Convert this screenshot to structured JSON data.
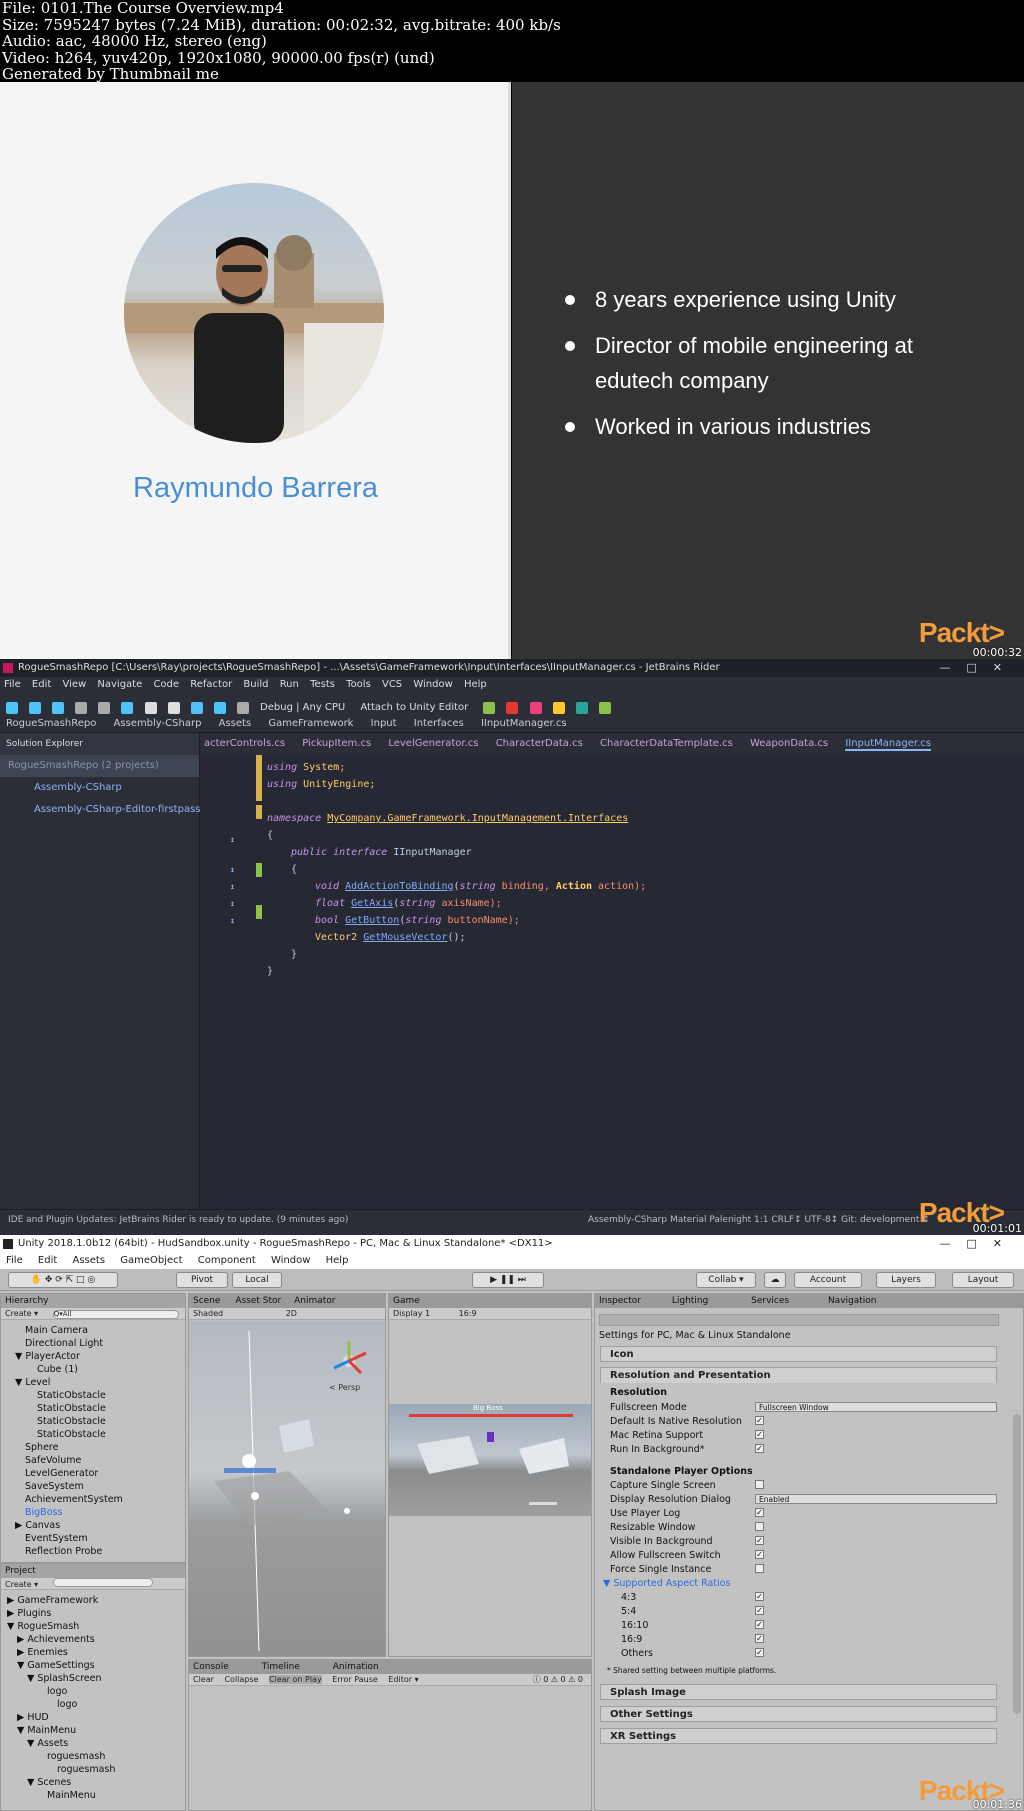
{
  "file_info": [
    "File: 0101.The Course Overview.mp4",
    "Size: 7595247 bytes (7.24 MiB), duration: 00:02:32, avg.bitrate: 400 kb/s",
    "Audio: aac, 48000 Hz, stereo (eng)",
    "Video: h264, yuv420p, 1920x1080, 90000.00 fps(r) (und)",
    "Generated by Thumbnail me"
  ],
  "brand": "Packt>",
  "frame1": {
    "timestamp": "00:00:32",
    "presenter_name": "Raymundo Barrera",
    "bullets": [
      "8 years experience using Unity",
      "Director of mobile engineering at edutech company",
      "Worked in various industries"
    ]
  },
  "frame2": {
    "timestamp": "00:01:01",
    "title": "RogueSmashRepo [C:\\Users\\Ray\\projects\\RogueSmashRepo] - ...\\Assets\\GameFramework\\Input\\Interfaces\\IInputManager.cs - JetBrains Rider",
    "menu": [
      "File",
      "Edit",
      "View",
      "Navigate",
      "Code",
      "Refactor",
      "Build",
      "Run",
      "Tests",
      "Tools",
      "VCS",
      "Window",
      "Help"
    ],
    "run_config": "Debug | Any CPU",
    "attach_label": "Attach to Unity Editor",
    "breadcrumb": [
      "RogueSmashRepo",
      "Assembly-CSharp",
      "Assets",
      "GameFramework",
      "Input",
      "Interfaces",
      "IInputManager.cs"
    ],
    "tabs": [
      "acterControls.cs",
      "PickupItem.cs",
      "LevelGenerator.cs",
      "CharacterData.cs",
      "CharacterDataTemplate.cs",
      "WeaponData.cs",
      "IInputManager.cs"
    ],
    "solution_header": "Solution Explorer",
    "solution_items": [
      "RogueSmashRepo (2 projects)",
      "Assembly-CSharp",
      "Assembly-CSharp-Editor-firstpass"
    ],
    "code": {
      "l1_kw": "using",
      "l1_id": "System;",
      "l2_kw": "using",
      "l2_id": "UnityEngine;",
      "l4_kw": "namespace",
      "l4_ns": "MyCompany.GameFramework.InputManagement.Interfaces",
      "l5": "{",
      "l6_kw": "public interface",
      "l6_id": "IInputManager",
      "l7": "{",
      "l8_ty": "void",
      "l8_fn": "AddActionToBinding",
      "l8_a": "(",
      "l8_kw1": "string",
      "l8_p1": " binding, ",
      "l8_ty2": "Action",
      "l8_p2": " action);",
      "l9_ty": "float",
      "l9_fn": "GetAxis",
      "l9_a": "(",
      "l9_kw": "string",
      "l9_p": " axisName);",
      "l10_ty": "bool",
      "l10_fn": "GetButton",
      "l10_a": "(",
      "l10_kw": "string",
      "l10_p": " buttonName);",
      "l11_ty": "Vector2",
      "l11_fn": "GetMouseVector",
      "l11_p": "();",
      "l12": "}",
      "l13": "}"
    },
    "status_left": "IDE and Plugin Updates: JetBrains Rider is ready to update. (9 minutes ago)",
    "status_right": "Assembly-CSharp    Material Palenight    1:1   CRLF↕   UTF-8↕   Git: development ↕"
  },
  "frame3": {
    "timestamp": "00:01:36",
    "title": "Unity 2018.1.0b12 (64bit) - HudSandbox.unity - RogueSmashRepo - PC, Mac & Linux Standalone* <DX11>",
    "menu": [
      "File",
      "Edit",
      "Assets",
      "GameObject",
      "Component",
      "Window",
      "Help"
    ],
    "toolbar": {
      "pivot": "Pivot",
      "local": "Local",
      "collab": "Collab ▾",
      "account": "Account",
      "layers": "Layers",
      "layout": "Layout"
    },
    "hierarchy_tab": "Hierarchy",
    "hierarchy_create": "Create ▾",
    "hierarchy_search": "Q▾All",
    "hierarchy": [
      "Main Camera",
      "Directional Light",
      "▼ PlayerActor",
      "Cube (1)",
      "▼ Level",
      "StaticObstacle",
      "StaticObstacle",
      "StaticObstacle",
      "StaticObstacle",
      "Sphere",
      "SafeVolume",
      "LevelGenerator",
      "SaveSystem",
      "AchievementSystem",
      "BigBoss",
      "▶ Canvas",
      "EventSystem",
      "Reflection Probe"
    ],
    "project_tab": "Project",
    "project_create": "Create ▾",
    "project": [
      "▶ GameFramework",
      "▶ Plugins",
      "▼ RogueSmash",
      "▶ Achievements",
      "▶ Enemies",
      "▼ GameSettings",
      "▼ SplashScreen",
      "logo",
      "logo",
      "▶ HUD",
      "▼ MainMenu",
      "▼ Assets",
      "roguesmash",
      "roguesmash",
      "▼ Scenes",
      "MainMenu"
    ],
    "scene_tab": "Scene",
    "asset_store_tab": "Asset Stor",
    "animator_tab": "Animator",
    "shaded": "Shaded",
    "mode_2d": "2D",
    "persp": "< Persp",
    "game_tab": "Game",
    "display": "Display 1",
    "aspect": "16:9",
    "game_label": "Big Boss",
    "console_tab": "Console",
    "timeline_tab": "Timeline",
    "animation_tab": "Animation",
    "console_buttons": [
      "Clear",
      "Collapse",
      "Clear on Play",
      "Error Pause",
      "Editor ▾"
    ],
    "console_counts": [
      "0",
      "0",
      "0"
    ],
    "inspector_tabs": [
      "Inspector",
      "Lighting",
      "Services",
      "Navigation"
    ],
    "inspector_title": "Settings for PC, Mac & Linux Standalone",
    "sections": [
      "Icon",
      "Resolution and Presentation",
      "Splash Image",
      "Other Settings",
      "XR Settings"
    ],
    "resolution_head": "Resolution",
    "fullscreen_mode_label": "Fullscreen Mode",
    "fullscreen_mode_value": "Fullscreen Window",
    "resolution_rows": [
      "Default Is Native Resolution",
      "Mac Retina Support",
      "Run In Background*"
    ],
    "standalone_head": "Standalone Player Options",
    "standalone_rows": [
      "Capture Single Screen",
      "Display Resolution Dialog",
      "Use Player Log",
      "Resizable Window",
      "Visible In Background",
      "Allow Fullscreen Switch",
      "Force Single Instance"
    ],
    "display_dialog_value": "Enabled",
    "aspect_head": "▼ Supported Aspect Ratios",
    "aspect_rows": [
      "4:3",
      "5:4",
      "16:10",
      "16:9",
      "Others"
    ],
    "shared_note": "* Shared setting between multiple platforms."
  }
}
